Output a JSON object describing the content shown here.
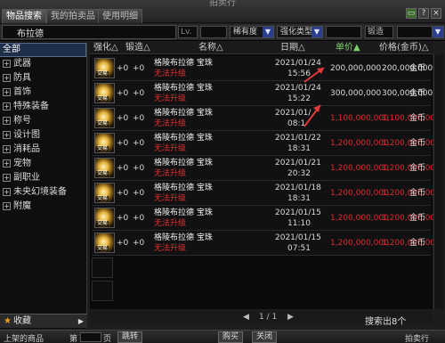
{
  "window": {
    "title": "拍卖行"
  },
  "tabs": [
    {
      "label": "物品搜索"
    },
    {
      "label": "我的拍卖品"
    },
    {
      "label": "使用明细"
    }
  ],
  "filter": {
    "search_value": "布拉德",
    "level_label": "Lv.",
    "rarity_select": "稀有度",
    "enhance_select": "强化类型",
    "forge_label": "锻造"
  },
  "sidebar": {
    "items": [
      {
        "label": "全部",
        "has_plus": false,
        "selected": true
      },
      {
        "label": "武器",
        "has_plus": true
      },
      {
        "label": "防具",
        "has_plus": true
      },
      {
        "label": "首饰",
        "has_plus": true
      },
      {
        "label": "特殊装备",
        "has_plus": true
      },
      {
        "label": "称号",
        "has_plus": true
      },
      {
        "label": "设计图",
        "has_plus": true
      },
      {
        "label": "消耗品",
        "has_plus": true
      },
      {
        "label": "宠物",
        "has_plus": true
      },
      {
        "label": "副职业",
        "has_plus": true
      },
      {
        "label": "未央幻境装备",
        "has_plus": true
      },
      {
        "label": "附魔",
        "has_plus": true
      }
    ],
    "favorites_label": "收藏"
  },
  "table": {
    "headers": {
      "enhance": "强化△",
      "forge": "锻造△",
      "name": "名称△",
      "date": "日期△",
      "unit_price": "单价▲",
      "total_price": "价格(金币)△"
    },
    "rows": [
      {
        "enhance": "+0",
        "forge": "+0",
        "name": "格陵布拉德 宝珠",
        "status": "无法升级",
        "date": "2021/01/24",
        "time": "15:56",
        "unit_price": "200,000,000",
        "total_price": "200,000,000",
        "currency": "金币",
        "red": false
      },
      {
        "enhance": "+0",
        "forge": "+0",
        "name": "格陵布拉德 宝珠",
        "status": "无法升级",
        "date": "2021/01/24",
        "time": "15:22",
        "unit_price": "300,000,000",
        "total_price": "300,000,000",
        "currency": "金币",
        "red": false
      },
      {
        "enhance": "+0",
        "forge": "+0",
        "name": "格陵布拉德 宝珠",
        "status": "无法升级",
        "date": "2021/01/",
        "time": "08:1",
        "unit_price": "1,100,000,000",
        "total_price": "1,100,000,000",
        "currency": "金币",
        "red": true
      },
      {
        "enhance": "+0",
        "forge": "+0",
        "name": "格陵布拉德 宝珠",
        "status": "无法升级",
        "date": "2021/01/22",
        "time": "18:31",
        "unit_price": "1,200,000,000",
        "total_price": "1,200,000,000",
        "currency": "金币",
        "red": true
      },
      {
        "enhance": "+0",
        "forge": "+0",
        "name": "格陵布拉德 宝珠",
        "status": "无法升级",
        "date": "2021/01/21",
        "time": "20:32",
        "unit_price": "1,200,000,000",
        "total_price": "1,200,000,000",
        "currency": "金币",
        "red": true
      },
      {
        "enhance": "+0",
        "forge": "+0",
        "name": "格陵布拉德 宝珠",
        "status": "无法升级",
        "date": "2021/01/18",
        "time": "18:31",
        "unit_price": "1,200,000,000",
        "total_price": "1,200,000,000",
        "currency": "金币",
        "red": true
      },
      {
        "enhance": "+0",
        "forge": "+0",
        "name": "格陵布拉德 宝珠",
        "status": "无法升级",
        "date": "2021/01/15",
        "time": "11:10",
        "unit_price": "1,200,000,000",
        "total_price": "1,200,000,000",
        "currency": "金币",
        "red": true
      },
      {
        "enhance": "+0",
        "forge": "+0",
        "name": "格陵布拉德 宝珠",
        "status": "无法升级",
        "date": "2021/01/15",
        "time": "07:51",
        "unit_price": "1,200,000,000",
        "total_price": "1,200,000,000",
        "currency": "金币",
        "red": true
      }
    ],
    "icon_badge": "交易"
  },
  "pager": {
    "text": "1 / 1",
    "results": "搜索出8个"
  },
  "bottom": {
    "left_label": "上架的商品",
    "page_label": "第",
    "page_value": "",
    "page_suffix": "页",
    "jump_label": "跳转",
    "btn1": "购买",
    "btn2": "关闭",
    "right_label": "拍卖行"
  },
  "colors": {
    "accent_green": "#7fd06a",
    "price_red": "#e02a2a",
    "annotation_red": "#e03a3a"
  }
}
